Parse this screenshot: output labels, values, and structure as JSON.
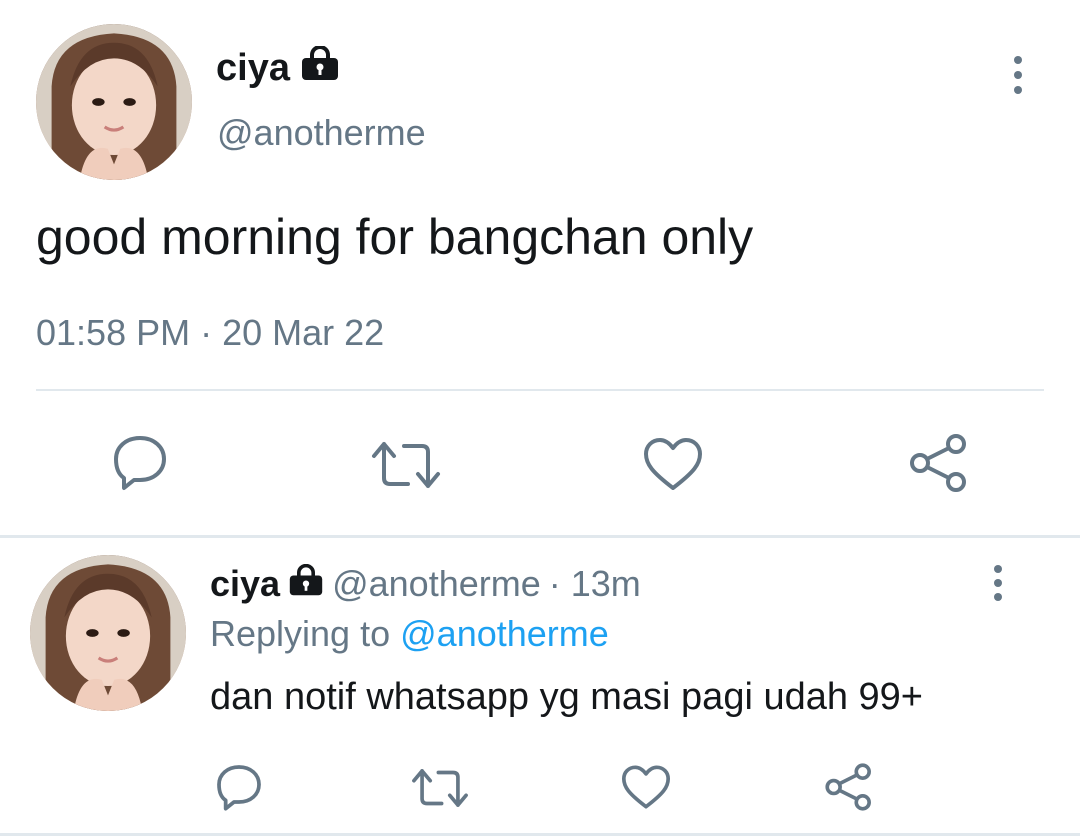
{
  "main_tweet": {
    "display_name": "ciya",
    "handle": "@anotherme",
    "text": "good morning for bangchan only",
    "timestamp": "01:58 PM · 20 Mar 22",
    "actions": [
      "reply-icon",
      "retweet-icon",
      "like-icon",
      "share-icon"
    ]
  },
  "reply_tweet": {
    "display_name": "ciya",
    "handle": "@anotherme",
    "time_ago": "· 13m",
    "replying_label": "Replying to",
    "replying_handle": "@anotherme",
    "text": "dan notif whatsapp yg masi pagi udah 99+",
    "actions": [
      "reply-icon",
      "retweet-icon",
      "like-icon",
      "share-icon"
    ]
  },
  "colors": {
    "text": "#14171a",
    "secondary": "#657786",
    "link": "#1da1f2",
    "divider": "#e1e8ed"
  }
}
